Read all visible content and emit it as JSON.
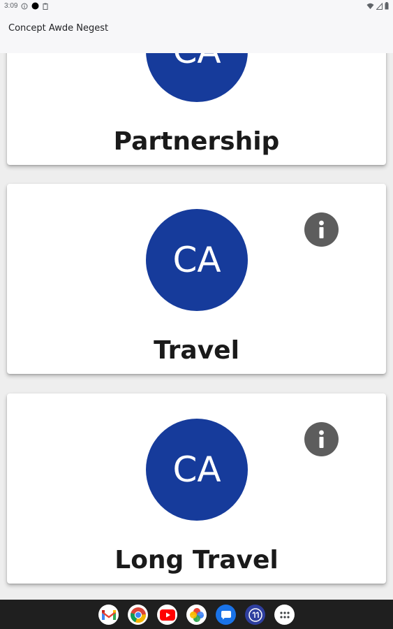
{
  "status_bar": {
    "time": "3:09",
    "icons": [
      "info-icon",
      "dot-icon",
      "clipboard-icon",
      "wifi-icon",
      "signal-icon",
      "battery-icon"
    ]
  },
  "app_bar": {
    "title": "Concept Awde Negest"
  },
  "cards": [
    {
      "avatar_text": "CA",
      "title": "Partnership",
      "has_info": false
    },
    {
      "avatar_text": "CA",
      "title": "Travel",
      "has_info": true
    },
    {
      "avatar_text": "CA",
      "title": "Long Travel",
      "has_info": true
    }
  ],
  "colors": {
    "avatar": "#163b9b",
    "info_button": "#5d5d5d",
    "app_bar": "#f7f7f9",
    "nav_bar": "#1f1f1f"
  },
  "dock": [
    "gmail-icon",
    "chrome-icon",
    "youtube-icon",
    "photos-icon",
    "messages-icon",
    "app-icon",
    "app-drawer-icon"
  ]
}
